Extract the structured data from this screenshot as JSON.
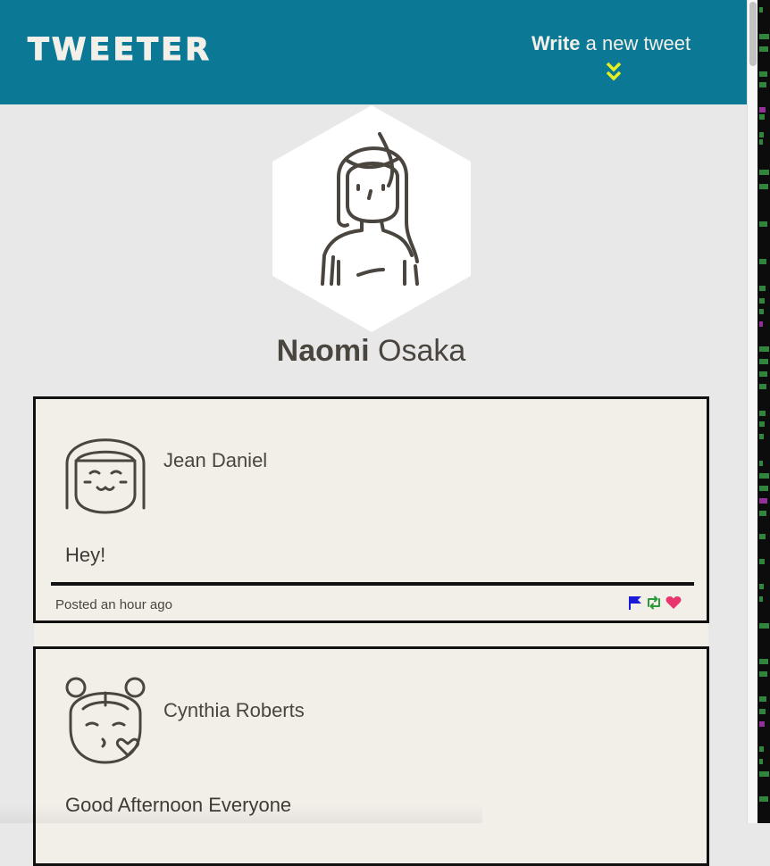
{
  "app": {
    "brand": "TWEETER",
    "compose": {
      "strong": "Write",
      "rest": " a new tweet"
    },
    "colors": {
      "nav": "#0b7996",
      "chevron": "#e4f021",
      "card": "#f2efe9"
    }
  },
  "profile": {
    "first": "Naomi",
    "last": " Osaka",
    "avatar_icon": "woman-avatar-icon"
  },
  "tweets": [
    {
      "author": "Jean Daniel",
      "content": "Hey!",
      "posted": "Posted an hour ago",
      "avatar_icon": "smiling-face-avatar-icon",
      "actions": [
        "flag-icon",
        "retweet-icon",
        "heart-icon"
      ]
    },
    {
      "author": "Cynthia Roberts",
      "content": "Good Afternoon Everyone",
      "avatar_icon": "kissing-face-avatar-icon"
    }
  ]
}
